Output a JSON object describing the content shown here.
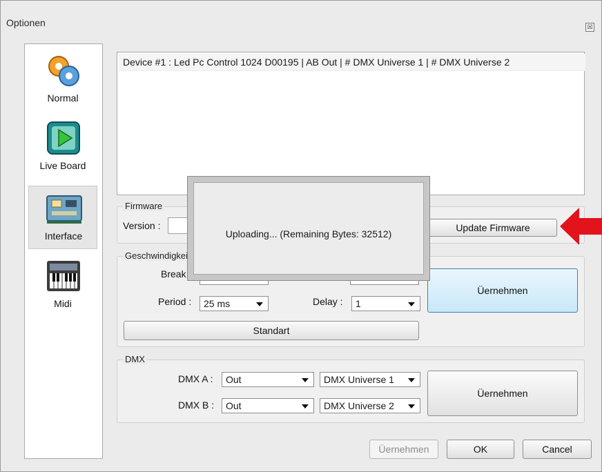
{
  "window": {
    "title": "Optionen",
    "close_glyph": "☒"
  },
  "sidebar": {
    "items": [
      {
        "label": "Normal",
        "icon": "gears-icon"
      },
      {
        "label": "Live Board",
        "icon": "play-board-icon"
      },
      {
        "label": "Interface",
        "icon": "circuit-board-icon"
      },
      {
        "label": "Midi",
        "icon": "keyboard-icon"
      }
    ],
    "selected": "Interface"
  },
  "devices": {
    "rows": [
      "Device #1 : Led Pc Control 1024 D00195 | AB Out | # DMX Universe 1 | # DMX Universe 2"
    ]
  },
  "firmware": {
    "group_label": "Firmware",
    "version_label": "Version :",
    "update_button": "Update Firmware"
  },
  "speed": {
    "group_label": "Geschwindigkeit",
    "break_label": "Break",
    "period_label": "Period :",
    "period_value": "25 ms",
    "delay_label": "Delay :",
    "delay_value": "1",
    "apply_button": "Üernehmen",
    "standard_button": "Standart"
  },
  "dmx": {
    "group_label": "DMX",
    "dmx_a_label": "DMX A :",
    "dmx_a_mode": "Out",
    "dmx_a_universe": "DMX Universe 1",
    "dmx_b_label": "DMX B :",
    "dmx_b_mode": "Out",
    "dmx_b_universe": "DMX Universe 2",
    "apply_button": "Üernehmen"
  },
  "footer": {
    "apply_button": "Üernehmen",
    "ok_button": "OK",
    "cancel_button": "Cancel"
  },
  "popup": {
    "message": "Uploading... (Remaining Bytes: 32512)"
  },
  "colors": {
    "arrow": "#e3121b",
    "accent": "#3c7fb1"
  }
}
